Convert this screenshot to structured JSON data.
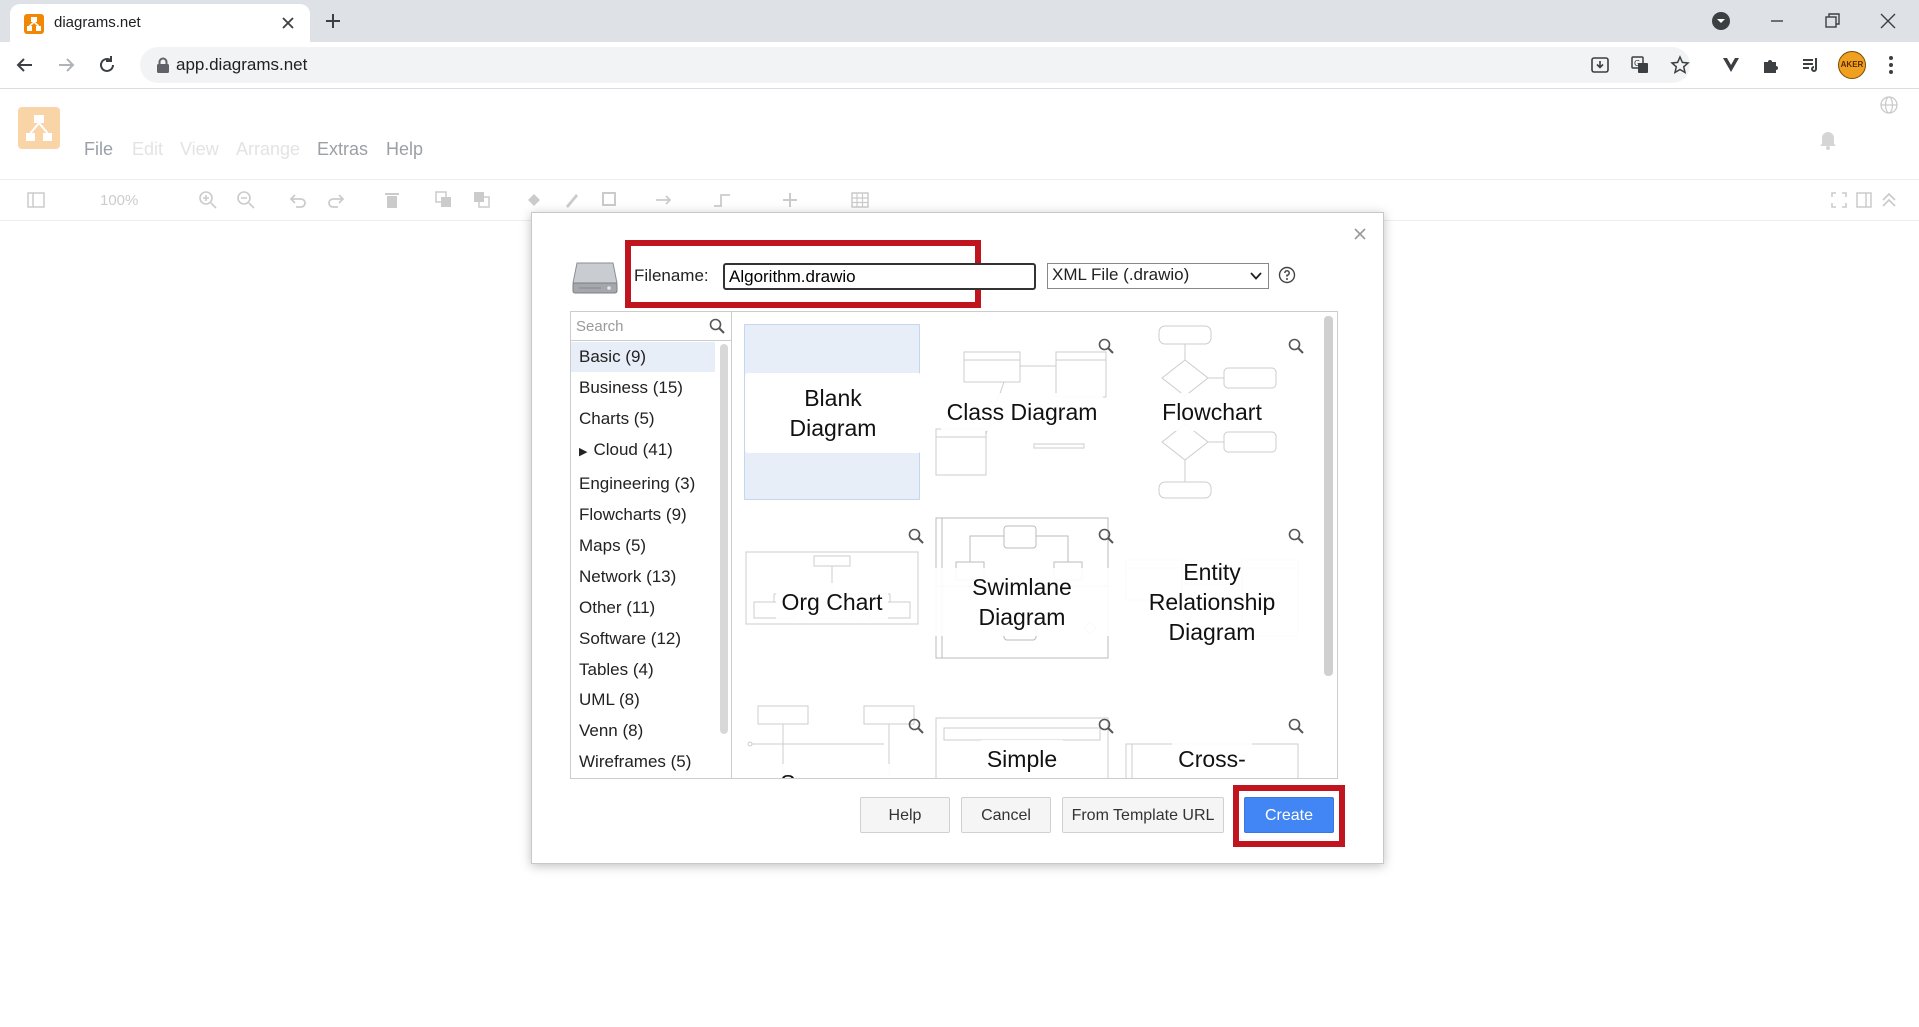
{
  "browser": {
    "tab_title": "diagrams.net",
    "url": "app.diagrams.net",
    "profile_label": "AKER"
  },
  "app": {
    "menu": {
      "file": "File",
      "edit": "Edit",
      "view": "View",
      "arrange": "Arrange",
      "extras": "Extras",
      "help": "Help"
    },
    "zoom": "100%"
  },
  "dialog": {
    "filename_label": "Filename:",
    "filename_value": "Algorithm.drawio",
    "format_selected": "XML File (.drawio)",
    "search_placeholder": "Search",
    "categories": [
      "Basic (9)",
      "Business (15)",
      "Charts (5)",
      "Cloud (41)",
      "Engineering (3)",
      "Flowcharts (9)",
      "Maps (5)",
      "Network (13)",
      "Other (11)",
      "Software (12)",
      "Tables (4)",
      "UML (8)",
      "Venn (8)",
      "Wireframes (5)"
    ],
    "templates": [
      "Blank Diagram",
      "Class Diagram",
      "Flowchart",
      "Org Chart",
      "Swimlane Diagram",
      "Entity Relationship Diagram",
      "Sequence",
      "Simple",
      "Cross-"
    ],
    "buttons": {
      "help": "Help",
      "cancel": "Cancel",
      "from_template_url": "From Template URL",
      "create": "Create"
    }
  },
  "colors": {
    "accent": "#4285f4",
    "highlight": "#c0141e",
    "drawio_orange": "#f08705",
    "selected_bg": "#e7eef8"
  }
}
